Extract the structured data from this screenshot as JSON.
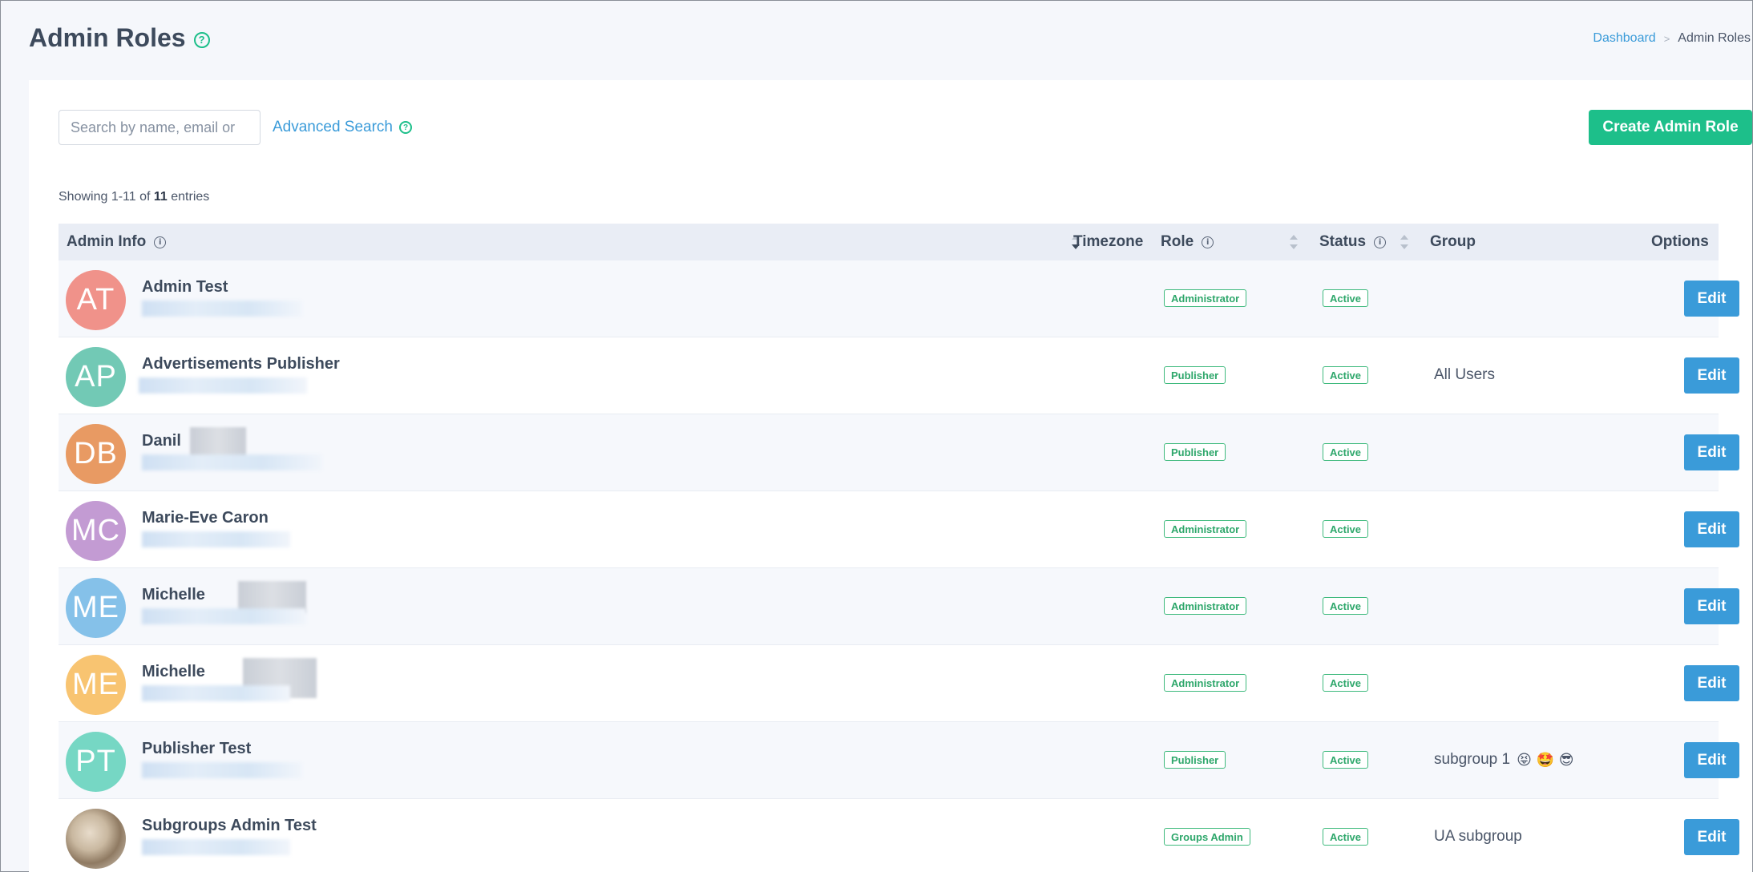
{
  "header": {
    "title": "Admin Roles",
    "help_glyph": "?",
    "breadcrumb": {
      "home": "Dashboard",
      "separator": ">",
      "current": "Admin Roles"
    }
  },
  "toolbar": {
    "search_placeholder": "Search by name, email or",
    "advanced_search": "Advanced Search",
    "create_button": "Create Admin Role"
  },
  "summary": {
    "prefix": "Showing 1-11 of ",
    "total": "11",
    "suffix": " entries"
  },
  "table": {
    "columns": {
      "admin_info": "Admin Info",
      "timezone": "Timezone",
      "role": "Role",
      "status": "Status",
      "group": "Group",
      "options": "Options"
    },
    "info_glyph": "i",
    "edit_label": "Edit",
    "rows": [
      {
        "initials": "AT",
        "name": "Admin Test",
        "avatar_color": "#f0928a",
        "role": "Administrator",
        "status": "Active",
        "group": ""
      },
      {
        "initials": "AP",
        "name": "Advertisements Publisher",
        "avatar_color": "#72c9b5",
        "role": "Publisher",
        "status": "Active",
        "group": "All Users"
      },
      {
        "initials": "DB",
        "name": "Danil",
        "avatar_color": "#e89a63",
        "role": "Publisher",
        "status": "Active",
        "group": ""
      },
      {
        "initials": "MC",
        "name": "Marie-Eve Caron",
        "avatar_color": "#c39bd3",
        "role": "Administrator",
        "status": "Active",
        "group": ""
      },
      {
        "initials": "ME",
        "name": "Michelle",
        "avatar_color": "#85c1e9",
        "role": "Administrator",
        "status": "Active",
        "group": ""
      },
      {
        "initials": "ME",
        "name": "Michelle",
        "avatar_color": "#f8c471",
        "role": "Administrator",
        "status": "Active",
        "group": ""
      },
      {
        "initials": "PT",
        "name": "Publisher Test",
        "avatar_color": "#76d7c4",
        "role": "Publisher",
        "status": "Active",
        "group": "subgroup 1",
        "group_emoji": "😝 🤩 😎"
      },
      {
        "initials": "",
        "name": "Subgroups Admin Test",
        "avatar_color": "#c9b8a0",
        "role": "Groups Admin",
        "status": "Active",
        "group": "UA subgroup"
      }
    ]
  }
}
